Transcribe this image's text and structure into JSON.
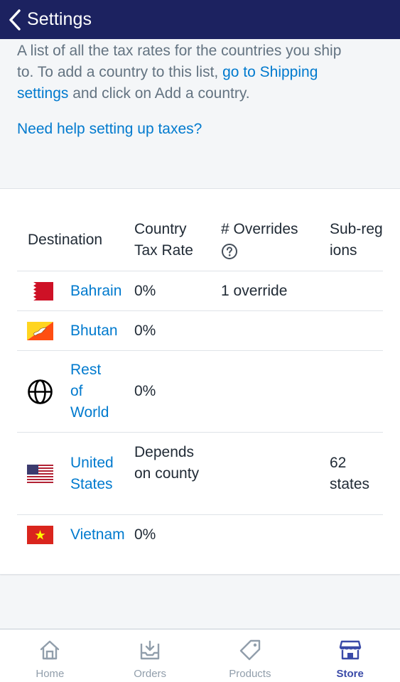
{
  "topbar": {
    "back_label": "Settings"
  },
  "intro": {
    "text_before": "A list of all the tax rates for the countries you ship to. To add a country to this list, ",
    "shipping_link": "go to Shipping settings",
    "text_after": " and click on Add a country.",
    "help_link": "Need help setting up taxes?"
  },
  "table": {
    "headers": {
      "destination": "Destination",
      "country_tax_rate": "Country Tax Rate",
      "overrides": "# Overrides",
      "subregions": "Sub-regions"
    },
    "rows": [
      {
        "country": "Bahrain",
        "rate": "0%",
        "overrides": "1 override",
        "subregions": "",
        "icon": "bahrain-flag-icon"
      },
      {
        "country": "Bhutan",
        "rate": "0%",
        "overrides": "",
        "subregions": "",
        "icon": "bhutan-flag-icon"
      },
      {
        "country": "Rest of World",
        "rate": "0%",
        "overrides": "",
        "subregions": "",
        "icon": "globe-icon"
      },
      {
        "country": "United States",
        "rate": "Depends on county",
        "overrides": "",
        "subregions": "62 states",
        "icon": "united-states-flag-icon"
      },
      {
        "country": "Vietnam",
        "rate": "0%",
        "overrides": "",
        "subregions": "",
        "icon": "vietnam-flag-icon"
      }
    ]
  },
  "tabbar": {
    "home": "Home",
    "orders": "Orders",
    "products": "Products",
    "store": "Store",
    "active": "Store"
  },
  "colors": {
    "header_bg": "#1c2260",
    "link": "#007ace",
    "active_tab": "#3a4aa8",
    "inactive_tab": "#919eab"
  }
}
